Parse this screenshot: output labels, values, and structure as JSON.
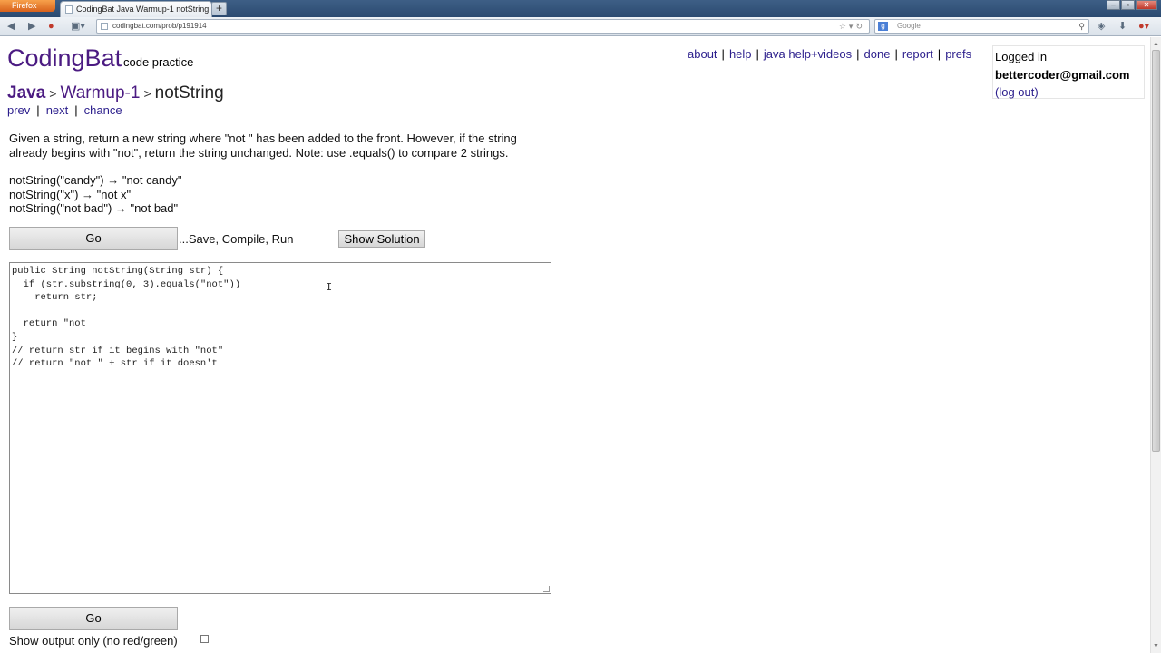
{
  "browser": {
    "menu_button": "Firefox",
    "tab_title": "CodingBat Java Warmup-1 notString",
    "new_tab": "+",
    "url": "codingbat.com/prob/p191914",
    "search_placeholder": "Google",
    "window_controls": [
      "minimize-icon",
      "maximize-icon",
      "close-icon"
    ]
  },
  "site": {
    "logo": "CodingBat",
    "tagline": "code practice"
  },
  "toplinks": [
    "about",
    "help",
    "java help+videos",
    "done",
    "report",
    "prefs"
  ],
  "login": {
    "status": "Logged in",
    "email": "bettercoder@gmail.com",
    "logout": "(log out)"
  },
  "breadcrumb": {
    "lang": "Java",
    "section": "Warmup-1",
    "separator": ">",
    "problem": "notString"
  },
  "subnav": [
    "prev",
    "next",
    "chance"
  ],
  "problem": {
    "description_line1": "Given a string, return a new string where \"not \" has been added to the front. However, if the string",
    "description_line2": "already begins with \"not\", return the string unchanged. Note: use .equals() to compare 2 strings.",
    "examples": [
      "notString(\"candy\") → \"not candy\"",
      "notString(\"x\") → \"not x\"",
      "notString(\"not bad\") → \"not bad\""
    ]
  },
  "controls": {
    "go_label": "Go",
    "save_text": "...Save, Compile, Run",
    "show_solution": "Show Solution",
    "output_only": "Show output only (no red/green)"
  },
  "code": "public String notString(String str) {\n  if (str.substring(0, 3).equals(\"not\"))\n    return str;\n\n  return \"not\n}\n// return str if it begins with \"not\"\n// return \"not \" + str if it doesn't"
}
